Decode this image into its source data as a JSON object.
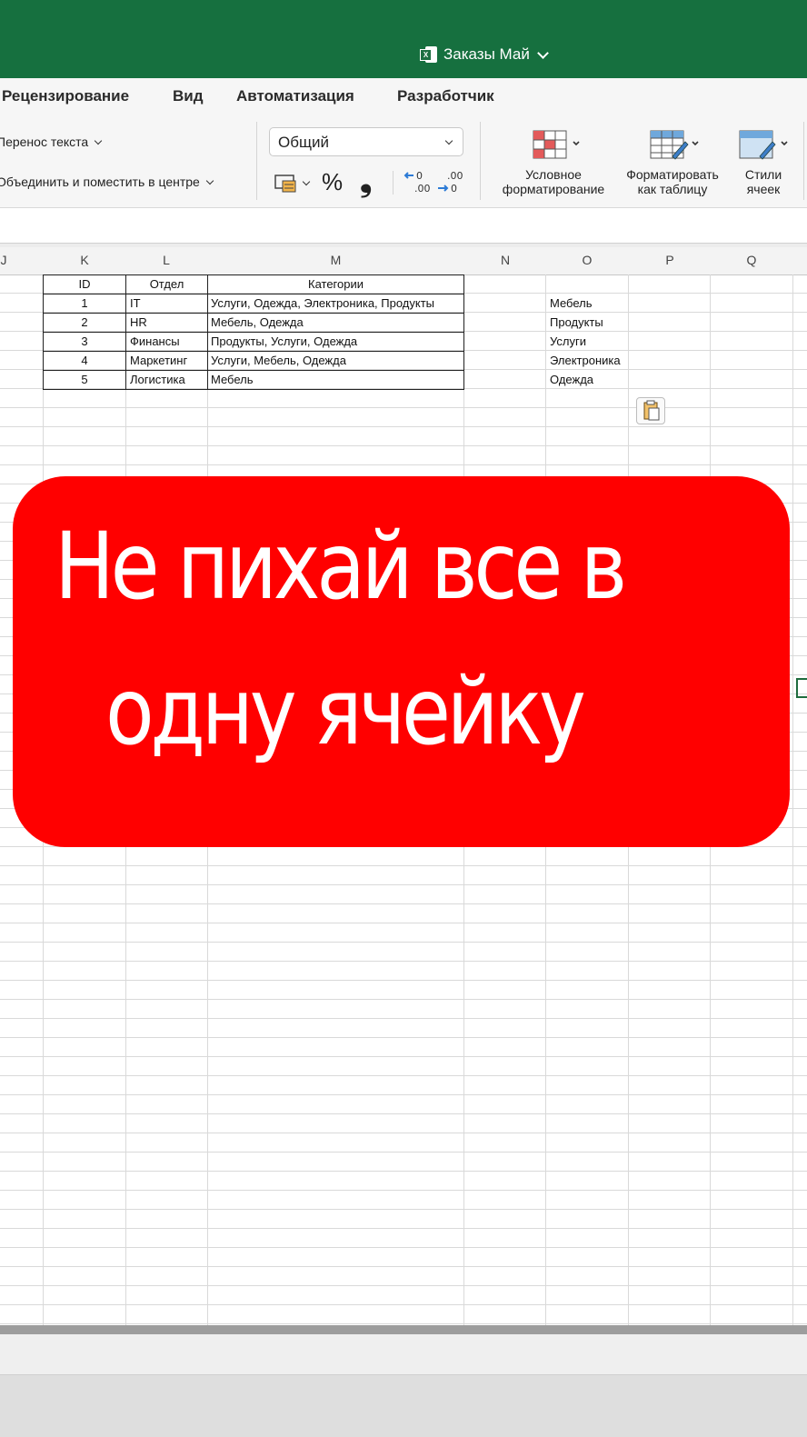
{
  "window": {
    "doc_title": "Заказы Май"
  },
  "tabs": [
    "Рецензирование",
    "Вид",
    "Автоматизация",
    "Разработчик"
  ],
  "ribbon": {
    "wrap_text": "Перенос текста",
    "merge_center": "Объединить и поместить в центре",
    "number_format": "Общий",
    "percent": "%",
    "comma": "❟",
    "conditional_formatting": [
      "Условное",
      "форматирование"
    ],
    "format_as_table": [
      "Форматировать",
      "как таблицу"
    ],
    "cell_styles": [
      "Стили",
      "ячеек"
    ]
  },
  "columns": [
    "J",
    "K",
    "L",
    "M",
    "N",
    "O",
    "P",
    "Q"
  ],
  "table": {
    "headers": [
      "ID",
      "Отдел",
      "Категории"
    ],
    "rows": [
      [
        "1",
        "IT",
        "Услуги, Одежда, Электроника, Продукты"
      ],
      [
        "2",
        "HR",
        "Мебель, Одежда"
      ],
      [
        "3",
        "Финансы",
        "Продукты, Услуги, Одежда"
      ],
      [
        "4",
        "Маркетинг",
        "Услуги, Мебель, Одежда"
      ],
      [
        "5",
        "Логистика",
        "Мебель"
      ]
    ]
  },
  "categories_list": [
    "Мебель",
    "Продукты",
    "Услуги",
    "Электроника",
    "Одежда"
  ],
  "banner": {
    "line1": "Не пихай все в",
    "line2": "одну ячейку",
    "color": "#ff0000"
  },
  "colors": {
    "titlebar": "#16703f",
    "ribbon_bg": "#f6f6f6"
  }
}
